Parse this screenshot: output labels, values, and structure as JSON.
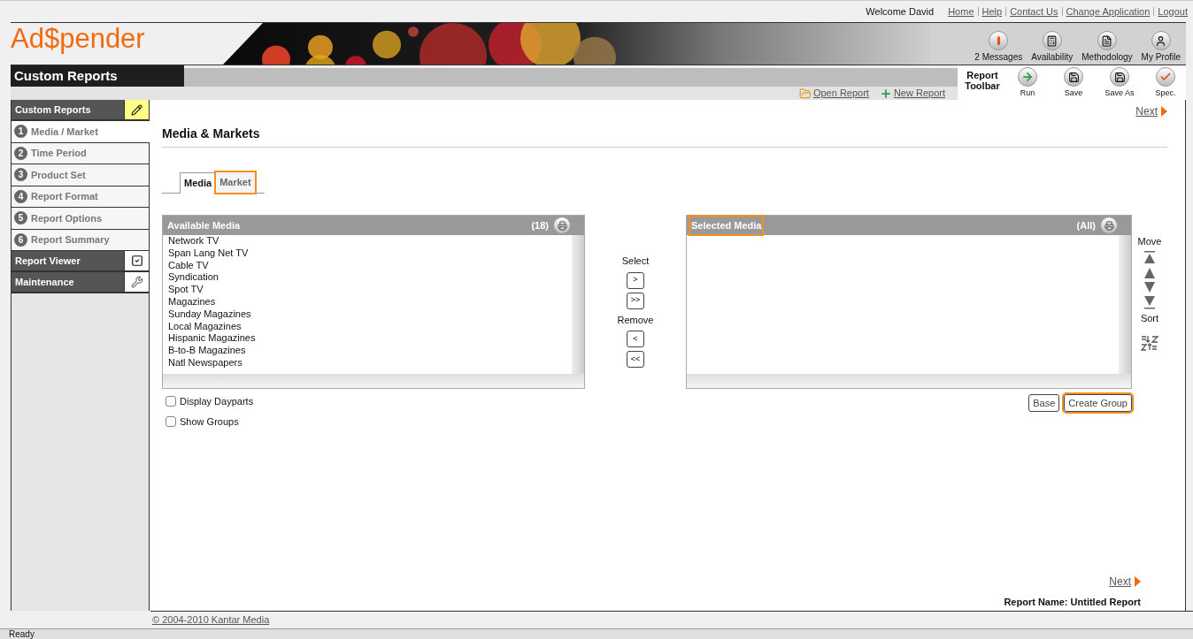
{
  "top_bar": {
    "welcome": "Welcome David",
    "links": [
      "Home",
      "Help",
      "Contact Us",
      "Change Application",
      "Logout"
    ]
  },
  "logo": "Ad$pender",
  "header_tools": [
    {
      "kind": "alert",
      "label": "2 Messages"
    },
    {
      "kind": "calc",
      "label": "Availability"
    },
    {
      "kind": "doc",
      "label": "Methodology"
    },
    {
      "kind": "person",
      "label": "My Profile"
    }
  ],
  "page_title": "Custom Reports",
  "report_links": [
    {
      "kind": "open",
      "label": "Open Report"
    },
    {
      "kind": "new",
      "label": "New Report"
    }
  ],
  "report_toolbar": {
    "title": "Report Toolbar",
    "buttons": [
      {
        "kind": "run",
        "label": "Run"
      },
      {
        "kind": "save",
        "label": "Save"
      },
      {
        "kind": "saveas",
        "label": "Save As"
      },
      {
        "kind": "spec",
        "label": "Spec."
      }
    ]
  },
  "sidebar": {
    "items": [
      {
        "kind": "section",
        "label": "Custom Reports",
        "active": true
      },
      {
        "kind": "step",
        "number": "1",
        "label": "Media / Market",
        "selected": true
      },
      {
        "kind": "step",
        "number": "2",
        "label": "Time Period",
        "selected": false
      },
      {
        "kind": "step",
        "number": "3",
        "label": "Product Set",
        "selected": false
      },
      {
        "kind": "step",
        "number": "4",
        "label": "Report Format",
        "selected": false
      },
      {
        "kind": "step",
        "number": "5",
        "label": "Report Options",
        "selected": false
      },
      {
        "kind": "step",
        "number": "6",
        "label": "Report Summary",
        "selected": false
      },
      {
        "kind": "section",
        "label": "Report Viewer",
        "active": false
      },
      {
        "kind": "section",
        "label": "Maintenance",
        "active": false
      }
    ]
  },
  "next_top": "Next",
  "heading": "Media & Markets",
  "tabs": [
    {
      "label": "Media",
      "selected": true,
      "highlighted": false
    },
    {
      "label": "Market",
      "selected": false,
      "highlighted": true
    }
  ],
  "available": {
    "title": "Available Media",
    "count": "(18)",
    "highlighted": false,
    "items": [
      "Network TV",
      "Span Lang Net TV",
      "Cable TV",
      "Syndication",
      "Spot TV",
      "Magazines",
      "Sunday Magazines",
      "Local Magazines",
      "Hispanic Magazines",
      "B-to-B Magazines",
      "Natl Newspapers"
    ]
  },
  "transfer": {
    "select_label": "Select",
    "select_buttons": [
      ">",
      ">>"
    ],
    "remove_label": "Remove",
    "remove_buttons": [
      "<",
      "<<"
    ]
  },
  "selected": {
    "title": "Selected Media",
    "count": "(All)",
    "highlighted": true
  },
  "move": {
    "move_label": "Move",
    "sort_label": "Sort"
  },
  "options": [
    {
      "label": "Display Dayparts",
      "checked": false
    },
    {
      "label": "Show Groups",
      "checked": false
    }
  ],
  "group_buttons": [
    {
      "label": "Base",
      "highlighted": false
    },
    {
      "label": "Create Group",
      "highlighted": true
    }
  ],
  "next_bottom": "Next",
  "report_name": "Report Name: Untitled Report",
  "copyright": "© 2004-2010 Kantar Media",
  "status": "Ready"
}
